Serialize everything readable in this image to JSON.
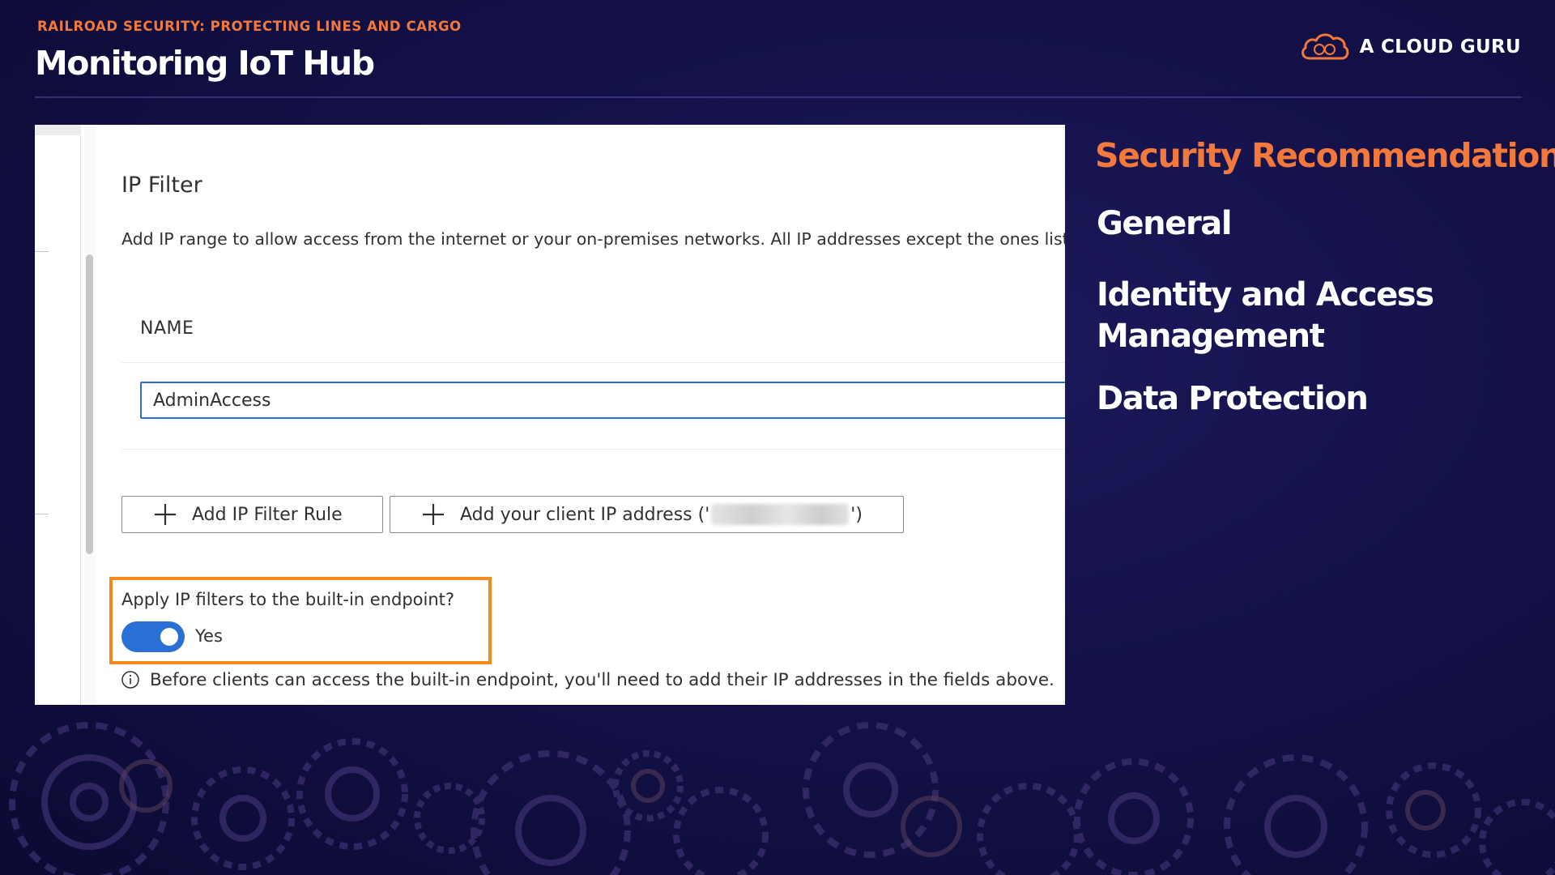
{
  "header": {
    "subtitle": "RAILROAD SECURITY: PROTECTING LINES AND CARGO",
    "title": "Monitoring IoT Hub"
  },
  "brand": {
    "name": "A CLOUD GURU",
    "icon": "cloud-logo-icon"
  },
  "ip_filter": {
    "title": "IP Filter",
    "description": "Add IP range to allow access from the internet or your on-premises networks. All IP addresses except the ones liste",
    "name_header": "NAME",
    "name_value": "AdminAccess",
    "add_rule_label": "Add IP Filter Rule",
    "add_client_prefix": "Add your client IP address ('",
    "add_client_suffix": "')",
    "apply_label": "Apply IP filters to the built-in endpoint?",
    "toggle_label": "Yes",
    "toggle_on": true,
    "info_text": "Before clients can access the built-in endpoint, you'll need to add their IP addresses in the fields above."
  },
  "side_list": {
    "heading": "Security Recommendations",
    "items": [
      "General",
      "Identity and Access Management",
      "Data Protection"
    ]
  },
  "colors": {
    "accent_orange": "#f2793b",
    "highlight_border": "#f28a1e",
    "toggle_blue": "#2a6fd6",
    "background": "#141149"
  }
}
